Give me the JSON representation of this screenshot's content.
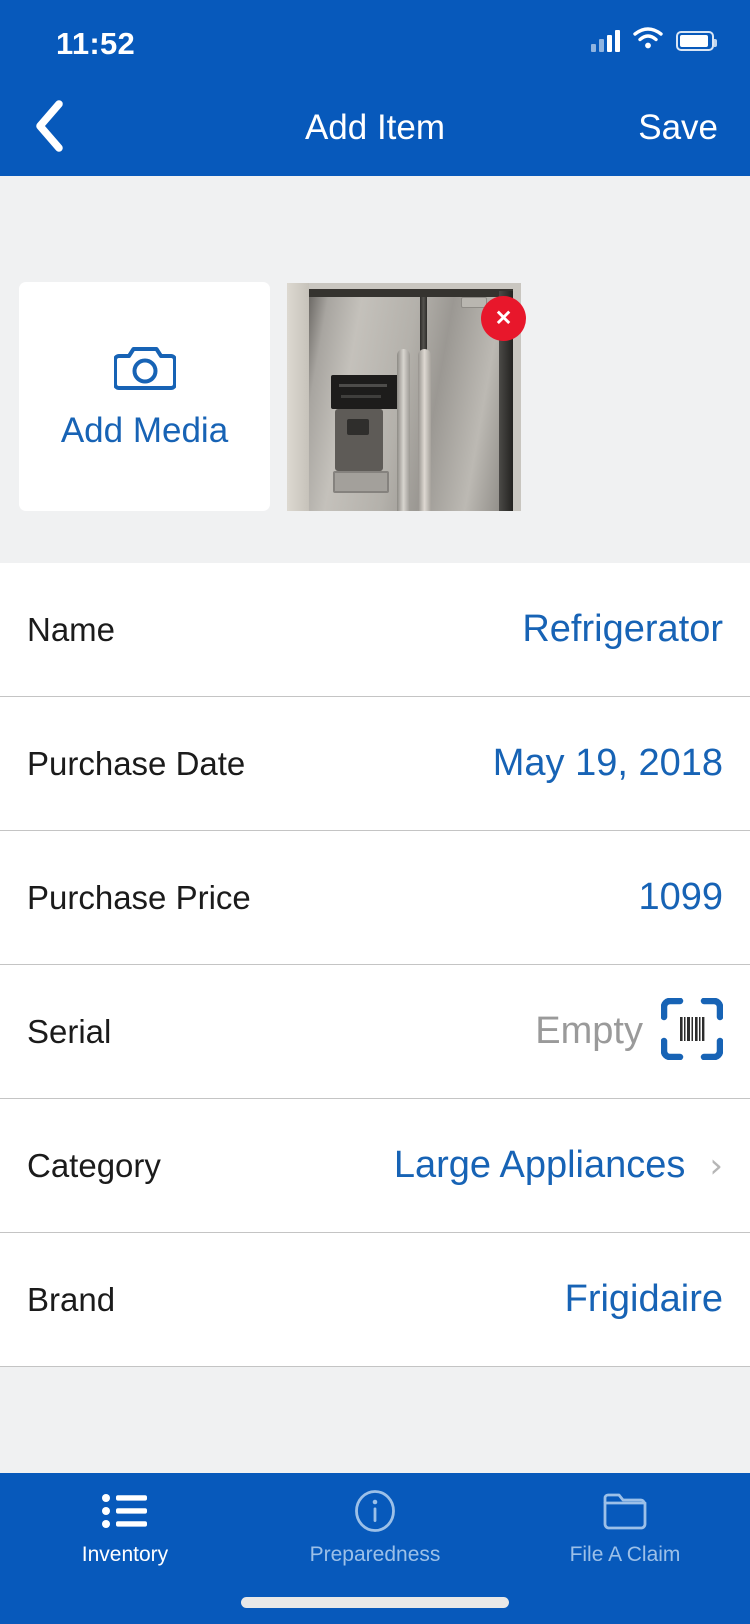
{
  "statusbar": {
    "time": "11:52",
    "signal_icon": "cellular-signal-icon",
    "wifi_icon": "wifi-icon",
    "battery_icon": "battery-icon"
  },
  "navbar": {
    "back_icon": "chevron-left-icon",
    "title": "Add Item",
    "save_label": "Save"
  },
  "media": {
    "add_media_label": "Add Media",
    "camera_icon": "camera-icon",
    "photo_name": "refrigerator-photo",
    "remove_icon": "close-x-icon",
    "remove_symbol": "✕"
  },
  "form": {
    "rows": [
      {
        "label": "Name",
        "value": "Refrigerator",
        "state": "filled",
        "accessory": "none"
      },
      {
        "label": "Purchase Date",
        "value": "May 19, 2018",
        "state": "filled",
        "accessory": "none"
      },
      {
        "label": "Purchase Price",
        "value": "1099",
        "state": "filled",
        "accessory": "none"
      },
      {
        "label": "Serial",
        "value": "Empty",
        "state": "empty",
        "accessory": "barcode-scan-icon"
      },
      {
        "label": "Category",
        "value": "Large Appliances",
        "state": "filled",
        "accessory": "chevron-right-icon"
      },
      {
        "label": "Brand",
        "value": "Frigidaire",
        "state": "filled",
        "accessory": "none"
      }
    ],
    "chevron_glyph": "›"
  },
  "tabbar": {
    "tabs": [
      {
        "label": "Inventory",
        "icon": "list-bullets-icon",
        "active": true
      },
      {
        "label": "Preparedness",
        "icon": "info-circle-icon",
        "active": false
      },
      {
        "label": "File A Claim",
        "icon": "folder-icon",
        "active": false
      }
    ]
  },
  "colors": {
    "brand_blue": "#0759bb",
    "link_blue": "#1763b5",
    "danger_red": "#e8172b",
    "page_gray": "#f0f1f2",
    "placeholder_gray": "#9a9a9a"
  }
}
